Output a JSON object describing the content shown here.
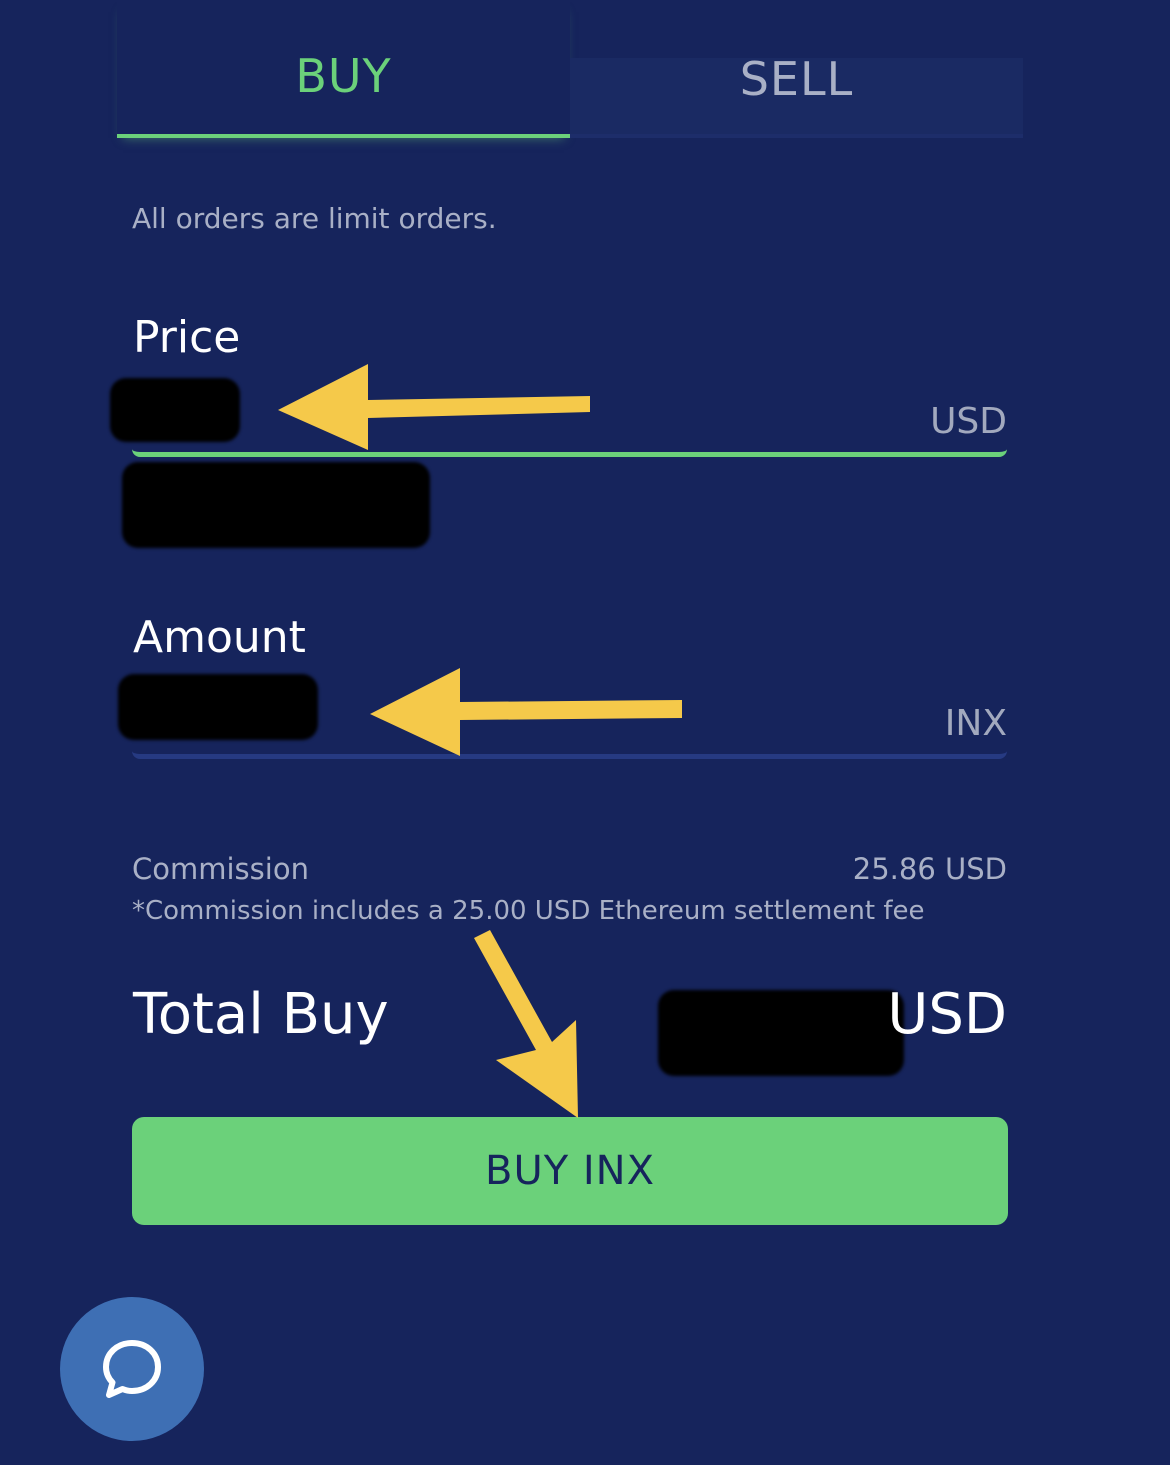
{
  "tabs": {
    "buy_label": "BUY",
    "sell_label": "SELL",
    "active": "BUY"
  },
  "note": "All orders are limit orders.",
  "price": {
    "label": "Price",
    "unit": "USD"
  },
  "amount": {
    "label": "Amount",
    "unit": "INX"
  },
  "commission": {
    "label": "Commission",
    "value": "25.86 USD",
    "note": "*Commission includes a 25.00 USD Ethereum settlement fee"
  },
  "total": {
    "label": "Total Buy",
    "unit": "USD"
  },
  "buy_button": {
    "label": "BUY INX"
  },
  "chat": {
    "icon": "chat-bubble-icon"
  },
  "colors": {
    "background": "#16245c",
    "accent_green": "#6bd17a",
    "annotation_arrow": "#f5c94a",
    "redaction": "#000000"
  }
}
